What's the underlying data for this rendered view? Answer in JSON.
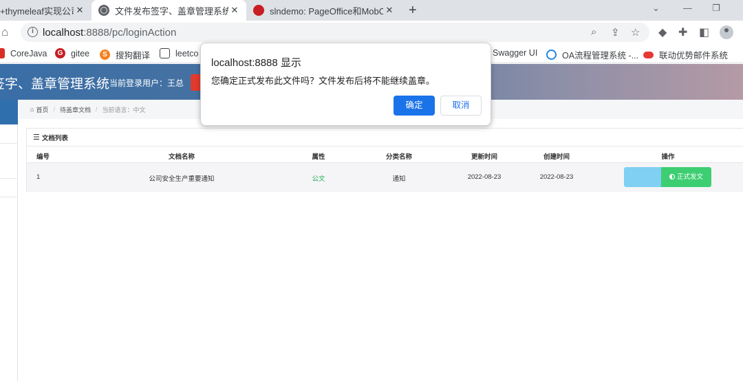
{
  "browser": {
    "tabs": [
      {
        "title": "+thymeleaf实现公司",
        "close": "✕"
      },
      {
        "title": "文件发布签字、盖章管理系统",
        "close": "✕"
      },
      {
        "title": "slndemo: PageOffice和MobOffi",
        "close": "✕"
      }
    ],
    "new_tab": "+",
    "url_host": "localhost",
    "url_path": ":8888/pc/loginAction",
    "bookmarks": [
      {
        "label": "CoreJava",
        "color": "#d93025"
      },
      {
        "label": "gitee",
        "color": "#c71d23"
      },
      {
        "label": "搜狗翻译",
        "color": "#f58220"
      },
      {
        "label": "leetco",
        "color": "#3c4043"
      },
      {
        "label": "Swagger UI",
        "color": "#85ea2d"
      },
      {
        "label": "OA流程管理系统 -...",
        "color": "#1e88e5"
      },
      {
        "label": "联动优势邮件系统",
        "color": "#e53935"
      }
    ]
  },
  "app": {
    "title": "签字、盖章管理系统",
    "user_label": "当前登录用户：王总",
    "breadcrumb": {
      "home": "首页",
      "section": "待盖章文档",
      "lang": "当前语言：中文"
    },
    "panel_title": "文档列表",
    "columns": [
      "编号",
      "文档名称",
      "属性",
      "分类名称",
      "更新时间",
      "创建时间",
      "操作"
    ],
    "rows": [
      {
        "id": "1",
        "name": "公司安全生产重要通知",
        "attr": "公文",
        "category": "通知",
        "updated": "2022-08-23",
        "created": "2022-08-23",
        "action_primary": "",
        "action_publish": "正式发文"
      }
    ]
  },
  "dialog": {
    "title": "localhost:8888 显示",
    "message": "您确定正式发布此文件吗？文件发布后将不能继续盖章。",
    "ok": "确定",
    "cancel": "取消"
  },
  "colors": {
    "ok_blue": "#1a73e8",
    "publish_green": "#3dce72",
    "attr_green": "#26b05e",
    "header_blue": "#3a6ea6"
  }
}
